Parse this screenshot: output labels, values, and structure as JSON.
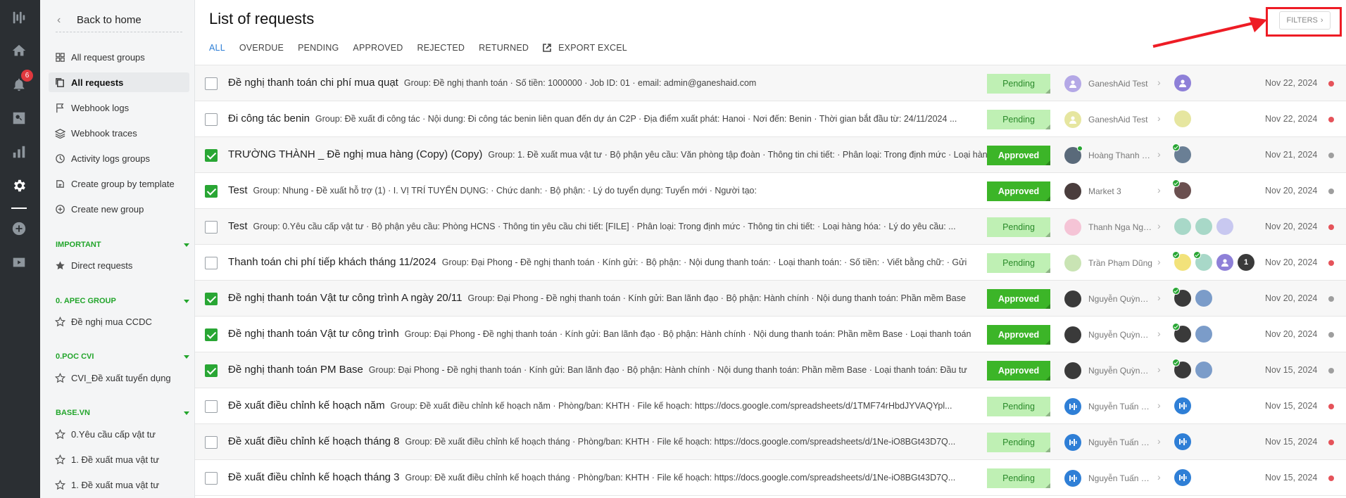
{
  "rail": {
    "notification_count": "6"
  },
  "sidebar": {
    "back_label": "Back to home",
    "items": [
      {
        "label": "All request groups",
        "icon": "grid-icon"
      },
      {
        "label": "All requests",
        "icon": "copy-icon",
        "active": true
      },
      {
        "label": "Webhook logs",
        "icon": "flag-icon"
      },
      {
        "label": "Webhook traces",
        "icon": "layers-icon"
      },
      {
        "label": "Activity logs groups",
        "icon": "clock-icon"
      },
      {
        "label": "Create group by template",
        "icon": "template-icon"
      },
      {
        "label": "Create new group",
        "icon": "plus-circle-icon"
      }
    ],
    "sections": [
      {
        "title": "IMPORTANT",
        "items": [
          "Direct requests"
        ]
      },
      {
        "title": "0. APEC GROUP",
        "items": [
          "Đề nghị mua CCDC"
        ]
      },
      {
        "title": "0.POC CVI",
        "items": [
          "CVI_Đề xuất tuyển dụng"
        ]
      },
      {
        "title": "BASE.VN",
        "items": [
          "0.Yêu cầu cấp vật tư",
          "1. Đề xuất mua vật tư",
          "1. Đề xuất mua vật tư"
        ]
      }
    ]
  },
  "header": {
    "title": "List of requests",
    "filters_label": "FILTERS",
    "tabs": [
      "ALL",
      "OVERDUE",
      "PENDING",
      "APPROVED",
      "REJECTED",
      "RETURNED"
    ],
    "export_label": "EXPORT EXCEL"
  },
  "colors": {
    "accent": "#2e7fd6",
    "approved": "#3cb528",
    "pending_bg": "#bff0b4",
    "highlight": "#ee1c25",
    "dot_red": "#e5535a",
    "dot_gray": "#9e9e9e"
  },
  "requests": [
    {
      "checked": false,
      "title": "Đề nghị thanh toán chi phí mua quạt",
      "detail": "Group: Đề nghị thanh toán · Số tiền: 1000000 · Job ID: 01 · email: admin@ganeshaid.com",
      "status": "Pending",
      "creator": "GaneshAid Test",
      "date": "Nov 22, 2024",
      "dot": "red"
    },
    {
      "checked": false,
      "title": "Đi công tác benin",
      "detail": "Group: Đề xuất đi công tác · Nội dung: Đi công tác benin liên quan đến dự án C2P · Địa điểm xuất phát: Hanoi · Nơi đến: Benin · Thời gian bắt đầu từ: 24/11/2024 ...",
      "status": "Pending",
      "creator": "GaneshAid Test",
      "date": "Nov 22, 2024",
      "dot": "red"
    },
    {
      "checked": true,
      "title": "TRƯỜNG THÀNH _ Đề nghị mua hàng (Copy) (Copy)",
      "detail": "Group: 1. Đề xuất mua vật tư · Bộ phận yêu cầu: Văn phòng tập đoàn · Thông tin chi tiết: · Phân loại: Trong định mức · Loại hàng hóa",
      "status": "Approved",
      "creator": "Hoàng Thanh N...",
      "date": "Nov 21, 2024",
      "dot": "gray"
    },
    {
      "checked": true,
      "title": "Test",
      "detail": "Group: Nhung - Đề xuất hỗ trợ (1) · I. VỊ TRÍ TUYỂN DỤNG: · Chức danh: · Bộ phận: · Lý do tuyển dụng: Tuyển mới · Người tạo:",
      "status": "Approved",
      "creator": "Market 3",
      "date": "Nov 20, 2024",
      "dot": "gray"
    },
    {
      "checked": false,
      "title": "Test",
      "detail": "Group: 0.Yêu cầu cấp vật tư · Bộ phận yêu cầu: Phòng HCNS · Thông tin yêu cầu chi tiết: [FILE] · Phân loại: Trong định mức · Thông tin chi tiết: · Loại hàng hóa: · Lý do yêu cầu: ...",
      "status": "Pending",
      "creator": "Thanh Nga Ngu...",
      "date": "Nov 20, 2024",
      "dot": "red"
    },
    {
      "checked": false,
      "title": "Thanh toán chi phí tiếp khách tháng 11/2024",
      "detail": "Group: Đại Phong - Đề nghị thanh toán · Kính gửi: · Bộ phận: · Nội dung thanh toán: · Loại thanh toán: · Số tiền: · Viết bằng chữ: · Gửi",
      "status": "Pending",
      "creator": "Trần Phạm Dũng",
      "date": "Nov 20, 2024",
      "dot": "red",
      "extra_count": "1"
    },
    {
      "checked": true,
      "title": "Đề nghị thanh toán Vật tư công trình A ngày 20/11",
      "detail": "Group: Đại Phong - Đề nghị thanh toán · Kính gửi: Ban lãnh đạo · Bộ phận: Hành chính · Nội dung thanh toán: Phần mềm Base",
      "status": "Approved",
      "creator": "Nguyễn Quỳnh T...",
      "date": "Nov 20, 2024",
      "dot": "gray"
    },
    {
      "checked": true,
      "title": "Đề nghị thanh toán Vật tư công trình",
      "detail": "Group: Đại Phong - Đề nghị thanh toán · Kính gửi: Ban lãnh đạo · Bộ phận: Hành chính · Nội dung thanh toán: Phần mềm Base · Loại thanh toán",
      "status": "Approved",
      "creator": "Nguyễn Quỳnh T...",
      "date": "Nov 20, 2024",
      "dot": "gray"
    },
    {
      "checked": true,
      "title": "Đề nghị thanh toán PM Base",
      "detail": "Group: Đại Phong - Đề nghị thanh toán · Kính gửi: Ban lãnh đạo · Bộ phận: Hành chính · Nội dung thanh toán: Phần mềm Base · Loại thanh toán: Đầu tư",
      "status": "Approved",
      "creator": "Nguyễn Quỳnh T...",
      "date": "Nov 15, 2024",
      "dot": "gray"
    },
    {
      "checked": false,
      "title": "Đề xuất điều chỉnh kế hoạch năm",
      "detail": "Group: Đề xuất điều chỉnh kế hoạch năm · Phòng/ban: KHTH · File kế hoạch: https://docs.google.com/spreadsheets/d/1TMF74rHbdJYVAQYpl...",
      "status": "Pending",
      "creator": "Nguyễn Tuấn Dư...",
      "date": "Nov 15, 2024",
      "dot": "red"
    },
    {
      "checked": false,
      "title": "Đề xuất điều chỉnh kế hoạch tháng 8",
      "detail": "Group: Đề xuất điều chỉnh kế hoạch tháng · Phòng/ban: KHTH · File kế hoạch: https://docs.google.com/spreadsheets/d/1Ne-iO8BGt43D7Q...",
      "status": "Pending",
      "creator": "Nguyễn Tuấn Dư...",
      "date": "Nov 15, 2024",
      "dot": "red"
    },
    {
      "checked": false,
      "title": "Đề xuất điều chỉnh kế hoạch tháng 3",
      "detail": "Group: Đề xuất điều chỉnh kế hoạch tháng · Phòng/ban: KHTH · File kế hoạch: https://docs.google.com/spreadsheets/d/1Ne-iO8BGt43D7Q...",
      "status": "Pending",
      "creator": "Nguyễn Tuấn Dư...",
      "date": "Nov 15, 2024",
      "dot": "red"
    }
  ]
}
